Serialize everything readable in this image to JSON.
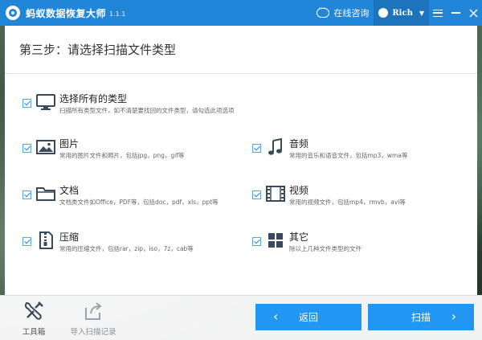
{
  "app": {
    "title": "蚂蚁数据恢复大师",
    "version": "1.1.1",
    "online_consult": "在线咨询",
    "user_name": "Rich",
    "user_caret": "▼"
  },
  "step": {
    "title": "第三步：请选择扫描文件类型"
  },
  "options": {
    "all": {
      "title": "选择所有的类型",
      "desc": "扫描所有类型文件，如不清楚要找回的文件类型，请勾选此项选项",
      "checked": true
    },
    "pictures": {
      "title": "图片",
      "desc": "常用的图片文件和照片，包括jpg，png，gif等",
      "checked": true
    },
    "audio": {
      "title": "音频",
      "desc": "常用的音乐和语音文件，包括mp3，wma等",
      "checked": true
    },
    "documents": {
      "title": "文档",
      "desc": "文档类文件如Office，PDF等，包括doc，pdf，xls，ppt等",
      "checked": true
    },
    "video": {
      "title": "视频",
      "desc": "常用的视频文件，包括mp4，rmvb，avi等",
      "checked": true
    },
    "archives": {
      "title": "压缩",
      "desc": "常用的压缩文件，包括rar，zip，iso，7z，cab等",
      "checked": true
    },
    "other": {
      "title": "其它",
      "desc": "除以上几种文件类型的文件",
      "checked": true
    }
  },
  "bottom": {
    "toolbox": "工具箱",
    "import_scan": "导入扫描记录",
    "back": "返回",
    "back_arrow": "‹",
    "scan": "扫描",
    "scan_arrow": "›"
  },
  "colors": {
    "accent": "#2185d8",
    "button": "#2196f3",
    "icon": "#3a4a5c"
  },
  "icons": {
    "all": "monitor-icon",
    "pictures": "image-icon",
    "audio": "music-note-icon",
    "documents": "folder-icon",
    "video": "film-icon",
    "archives": "zip-icon",
    "other": "grid-icon"
  }
}
